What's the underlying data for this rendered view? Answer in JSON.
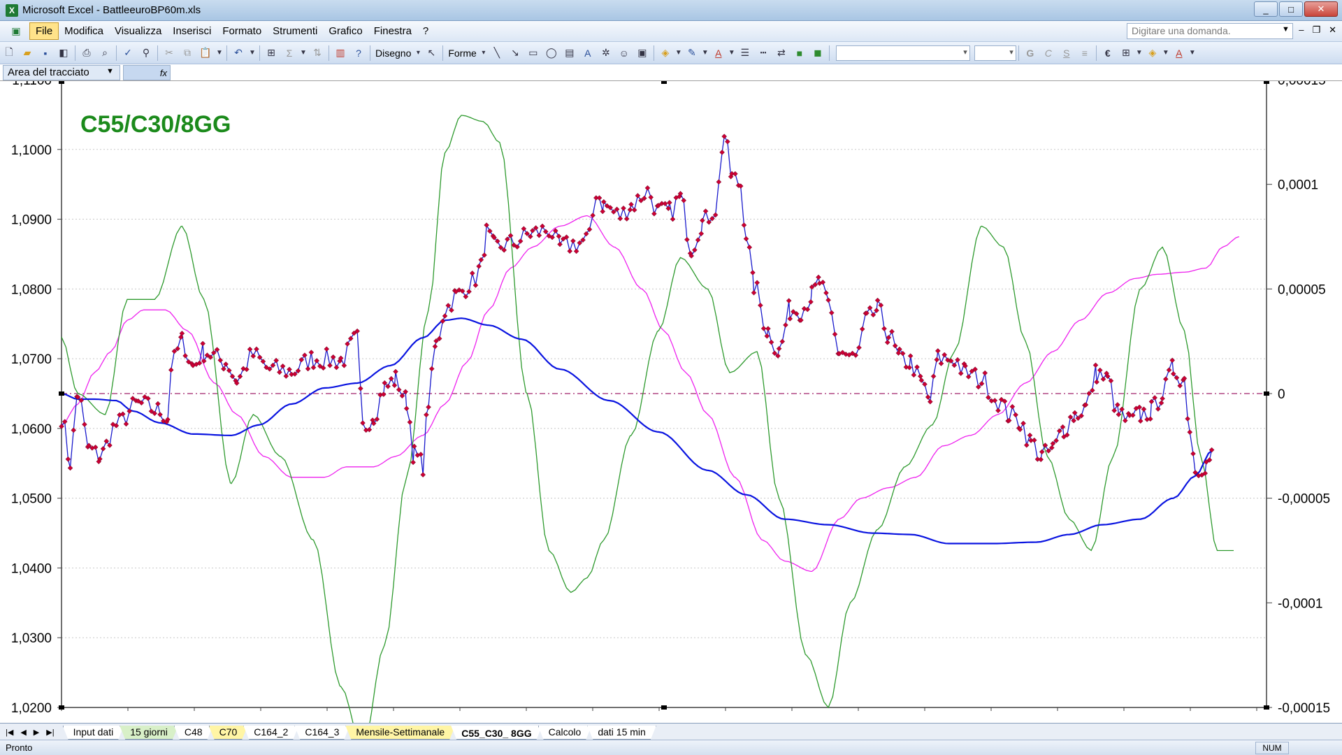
{
  "window": {
    "title": "Microsoft Excel - BattleeuroBP60m.xls",
    "app_icon": "X",
    "minimize": "_",
    "maximize": "□",
    "close": "✕"
  },
  "menu": {
    "items": [
      "File",
      "Modifica",
      "Visualizza",
      "Inserisci",
      "Formato",
      "Strumenti",
      "Grafico",
      "Finestra",
      "?"
    ],
    "active_index": 0,
    "ask_placeholder": "Digitare una domanda.",
    "mdi_minimize": "–",
    "mdi_restore": "❐",
    "mdi_close": "✕"
  },
  "toolbar": {
    "draw_label": "Disegno",
    "shapes_label": "Forme"
  },
  "formula_bar": {
    "name_box": "Area del tracciato",
    "fx": "fx"
  },
  "sheet_tabs": [
    {
      "label": "Input dati",
      "color": "white"
    },
    {
      "label": "15 giorni",
      "color": "green"
    },
    {
      "label": "C48",
      "color": "white"
    },
    {
      "label": "C70",
      "color": "yellow"
    },
    {
      "label": "C164_2",
      "color": "white"
    },
    {
      "label": "C164_3",
      "color": "white"
    },
    {
      "label": "Mensile-Settimanale",
      "color": "yellow"
    },
    {
      "label": "C55_C30_ 8GG",
      "color": "active"
    },
    {
      "label": "Calcolo",
      "color": "white"
    },
    {
      "label": "dati 15 min",
      "color": "white"
    }
  ],
  "status": {
    "text": "Pronto",
    "num": "NUM"
  },
  "colors": {
    "price": "#1a1acc",
    "marker": "#cc0033",
    "ma": "#0a14e0",
    "green_osc": "#2e9a2e",
    "magenta_osc": "#ee22ee",
    "zero_line": "#a0206a",
    "title": "#1b8a1b"
  },
  "chart_data": {
    "type": "line",
    "title": "C55/C30/8GG",
    "left_axis": {
      "min": 1.02,
      "max": 1.11,
      "ticks": [
        "1,0200",
        "1,0300",
        "1,0400",
        "1,0500",
        "1,0600",
        "1,0700",
        "1,0800",
        "1,0900",
        "1,1000",
        "1,1100"
      ]
    },
    "right_axis": {
      "min": -0.00015,
      "max": 0.00015,
      "ticks": [
        "-0,00015",
        "-0,0001",
        "-0,00005",
        "0",
        "0,00005",
        "0,0001",
        "0,00015"
      ]
    },
    "price_anchors": [
      [
        0,
        1.0618
      ],
      [
        8,
        1.0552
      ],
      [
        15,
        1.065
      ],
      [
        25,
        1.057
      ],
      [
        35,
        1.056
      ],
      [
        50,
        1.0605
      ],
      [
        70,
        1.0635
      ],
      [
        90,
        1.0625
      ],
      [
        97,
        1.0615
      ],
      [
        100,
        1.069
      ],
      [
        110,
        1.0725
      ],
      [
        120,
        1.069
      ],
      [
        130,
        1.071
      ],
      [
        150,
        1.0695
      ],
      [
        160,
        1.067
      ],
      [
        175,
        1.0705
      ],
      [
        190,
        1.0685
      ],
      [
        210,
        1.0682
      ],
      [
        230,
        1.07
      ],
      [
        255,
        1.0698
      ],
      [
        270,
        1.0728
      ],
      [
        275,
        1.06
      ],
      [
        285,
        1.062
      ],
      [
        295,
        1.0658
      ],
      [
        305,
        1.067
      ],
      [
        315,
        1.064
      ],
      [
        322,
        1.0562
      ],
      [
        330,
        1.0548
      ],
      [
        335,
        1.064
      ],
      [
        342,
        1.072
      ],
      [
        350,
        1.077
      ],
      [
        360,
        1.079
      ],
      [
        375,
        1.081
      ],
      [
        383,
        1.083
      ],
      [
        388,
        1.088
      ],
      [
        395,
        1.086
      ],
      [
        410,
        1.0865
      ],
      [
        430,
        1.088
      ],
      [
        445,
        1.0885
      ],
      [
        455,
        1.086
      ],
      [
        470,
        1.0865
      ],
      [
        482,
        1.0872
      ],
      [
        488,
        1.094
      ],
      [
        495,
        1.092
      ],
      [
        510,
        1.0905
      ],
      [
        520,
        1.092
      ],
      [
        535,
        1.094
      ],
      [
        545,
        1.091
      ],
      [
        555,
        1.091
      ],
      [
        565,
        1.093
      ],
      [
        575,
        1.086
      ],
      [
        585,
        1.0895
      ],
      [
        597,
        1.0915
      ],
      [
        605,
        1.102
      ],
      [
        612,
        1.096
      ],
      [
        620,
        1.095
      ],
      [
        625,
        1.088
      ],
      [
        632,
        1.0805
      ],
      [
        645,
        1.074
      ],
      [
        655,
        1.071
      ],
      [
        665,
        1.077
      ],
      [
        675,
        1.077
      ],
      [
        685,
        1.079
      ],
      [
        692,
        1.081
      ],
      [
        700,
        1.0775
      ],
      [
        710,
        1.071
      ],
      [
        725,
        1.07
      ],
      [
        735,
        1.0755
      ],
      [
        745,
        1.077
      ],
      [
        755,
        1.0735
      ],
      [
        765,
        1.07
      ],
      [
        775,
        1.0695
      ],
      [
        785,
        1.0665
      ],
      [
        793,
        1.064
      ],
      [
        800,
        1.07
      ],
      [
        815,
        1.07
      ],
      [
        825,
        1.068
      ],
      [
        840,
        1.067
      ],
      [
        855,
        1.064
      ],
      [
        865,
        1.062
      ],
      [
        875,
        1.061
      ],
      [
        885,
        1.058
      ],
      [
        895,
        1.056
      ],
      [
        905,
        1.057
      ],
      [
        915,
        1.06
      ],
      [
        925,
        1.062
      ],
      [
        935,
        1.063
      ],
      [
        945,
        1.068
      ],
      [
        955,
        1.067
      ],
      [
        965,
        1.062
      ],
      [
        975,
        1.061
      ],
      [
        985,
        1.062
      ],
      [
        995,
        1.0625
      ],
      [
        1005,
        1.065
      ],
      [
        1015,
        1.0685
      ],
      [
        1025,
        1.067
      ],
      [
        1030,
        1.06
      ],
      [
        1035,
        1.0545
      ],
      [
        1045,
        1.0548
      ],
      [
        1050,
        1.056
      ]
    ],
    "ma_anchors": [
      [
        0,
        1.065
      ],
      [
        15,
        1.0642
      ],
      [
        30,
        1.0642
      ],
      [
        50,
        1.064
      ],
      [
        65,
        1.0625
      ],
      [
        90,
        1.0608
      ],
      [
        120,
        1.0592
      ],
      [
        155,
        1.059
      ],
      [
        180,
        1.0605
      ],
      [
        210,
        1.0635
      ],
      [
        240,
        1.0658
      ],
      [
        270,
        1.0665
      ],
      [
        300,
        1.069
      ],
      [
        330,
        1.073
      ],
      [
        350,
        1.0755
      ],
      [
        365,
        1.0758
      ],
      [
        390,
        1.0748
      ],
      [
        420,
        1.0728
      ],
      [
        455,
        1.0685
      ],
      [
        500,
        1.064
      ],
      [
        545,
        1.0595
      ],
      [
        590,
        1.054
      ],
      [
        625,
        1.0505
      ],
      [
        660,
        1.047
      ],
      [
        700,
        1.0462
      ],
      [
        740,
        1.045
      ],
      [
        775,
        1.0448
      ],
      [
        810,
        1.0435
      ],
      [
        850,
        1.0435
      ],
      [
        890,
        1.0437
      ],
      [
        920,
        1.0448
      ],
      [
        950,
        1.0462
      ],
      [
        985,
        1.047
      ],
      [
        1015,
        1.05
      ],
      [
        1035,
        1.0532
      ],
      [
        1050,
        1.0568
      ]
    ],
    "green_osc_anchors": [
      [
        0,
        2.7e-05
      ],
      [
        15,
        0.0
      ],
      [
        40,
        -1e-05
      ],
      [
        60,
        4.5e-05
      ],
      [
        85,
        4.5e-05
      ],
      [
        110,
        8e-05
      ],
      [
        130,
        4.5e-05
      ],
      [
        155,
        -4.3e-05
      ],
      [
        175,
        -1e-05
      ],
      [
        200,
        -3e-05
      ],
      [
        230,
        -7e-05
      ],
      [
        255,
        -0.00014
      ],
      [
        275,
        -0.00017
      ],
      [
        295,
        -0.00012
      ],
      [
        315,
        -4e-05
      ],
      [
        335,
        4e-05
      ],
      [
        350,
        0.000115
      ],
      [
        365,
        0.000133
      ],
      [
        385,
        0.00013
      ],
      [
        400,
        0.00012
      ],
      [
        425,
        0.0
      ],
      [
        445,
        -7.5e-05
      ],
      [
        465,
        -9.5e-05
      ],
      [
        480,
        -8.8e-05
      ],
      [
        495,
        -7e-05
      ],
      [
        520,
        -2e-05
      ],
      [
        545,
        3e-05
      ],
      [
        565,
        6.5e-05
      ],
      [
        590,
        5e-05
      ],
      [
        610,
        1e-05
      ],
      [
        635,
        2e-05
      ],
      [
        655,
        -5e-05
      ],
      [
        680,
        -0.000125
      ],
      [
        700,
        -0.00015
      ],
      [
        720,
        -0.0001
      ],
      [
        745,
        -6.5e-05
      ],
      [
        770,
        -3.5e-05
      ],
      [
        795,
        -1.5e-05
      ],
      [
        815,
        2e-05
      ],
      [
        840,
        8e-05
      ],
      [
        860,
        7e-05
      ],
      [
        880,
        2.5e-05
      ],
      [
        900,
        -3e-05
      ],
      [
        920,
        -6e-05
      ],
      [
        940,
        -7.5e-05
      ],
      [
        960,
        -3e-05
      ],
      [
        985,
        5e-05
      ],
      [
        1005,
        7e-05
      ],
      [
        1025,
        3e-05
      ],
      [
        1040,
        -3e-05
      ],
      [
        1055,
        -7.5e-05
      ],
      [
        1070,
        -7.5e-05
      ]
    ],
    "magenta_osc_anchors": [
      [
        0,
        -1.5e-05
      ],
      [
        15,
        -5e-06
      ],
      [
        30,
        1e-05
      ],
      [
        45,
        2e-05
      ],
      [
        60,
        3.5e-05
      ],
      [
        75,
        4e-05
      ],
      [
        95,
        4e-05
      ],
      [
        115,
        3e-05
      ],
      [
        140,
        5e-06
      ],
      [
        160,
        -1e-05
      ],
      [
        185,
        -3e-05
      ],
      [
        210,
        -4e-05
      ],
      [
        240,
        -4e-05
      ],
      [
        260,
        -3.5e-05
      ],
      [
        285,
        -3.5e-05
      ],
      [
        305,
        -3e-05
      ],
      [
        330,
        -2e-05
      ],
      [
        350,
        -5e-06
      ],
      [
        370,
        1.5e-05
      ],
      [
        390,
        4e-05
      ],
      [
        410,
        6e-05
      ],
      [
        430,
        7e-05
      ],
      [
        455,
        8e-05
      ],
      [
        480,
        8.5e-05
      ],
      [
        505,
        7e-05
      ],
      [
        530,
        5e-05
      ],
      [
        550,
        3e-05
      ],
      [
        570,
        1e-05
      ],
      [
        590,
        -1e-05
      ],
      [
        615,
        -4e-05
      ],
      [
        640,
        -7e-05
      ],
      [
        660,
        -8e-05
      ],
      [
        685,
        -8.5e-05
      ],
      [
        710,
        -6e-05
      ],
      [
        730,
        -5e-05
      ],
      [
        755,
        -4.5e-05
      ],
      [
        780,
        -4e-05
      ],
      [
        805,
        -2.5e-05
      ],
      [
        830,
        -2e-05
      ],
      [
        855,
        -1e-05
      ],
      [
        880,
        5e-06
      ],
      [
        905,
        2e-05
      ],
      [
        930,
        3.5e-05
      ],
      [
        955,
        4.8e-05
      ],
      [
        980,
        5.5e-05
      ],
      [
        1000,
        5.7e-05
      ],
      [
        1025,
        5.8e-05
      ],
      [
        1045,
        6e-05
      ],
      [
        1060,
        7e-05
      ],
      [
        1075,
        7.5e-05
      ]
    ],
    "zero_line": 0,
    "grid": "horizontal",
    "legend": "none"
  }
}
